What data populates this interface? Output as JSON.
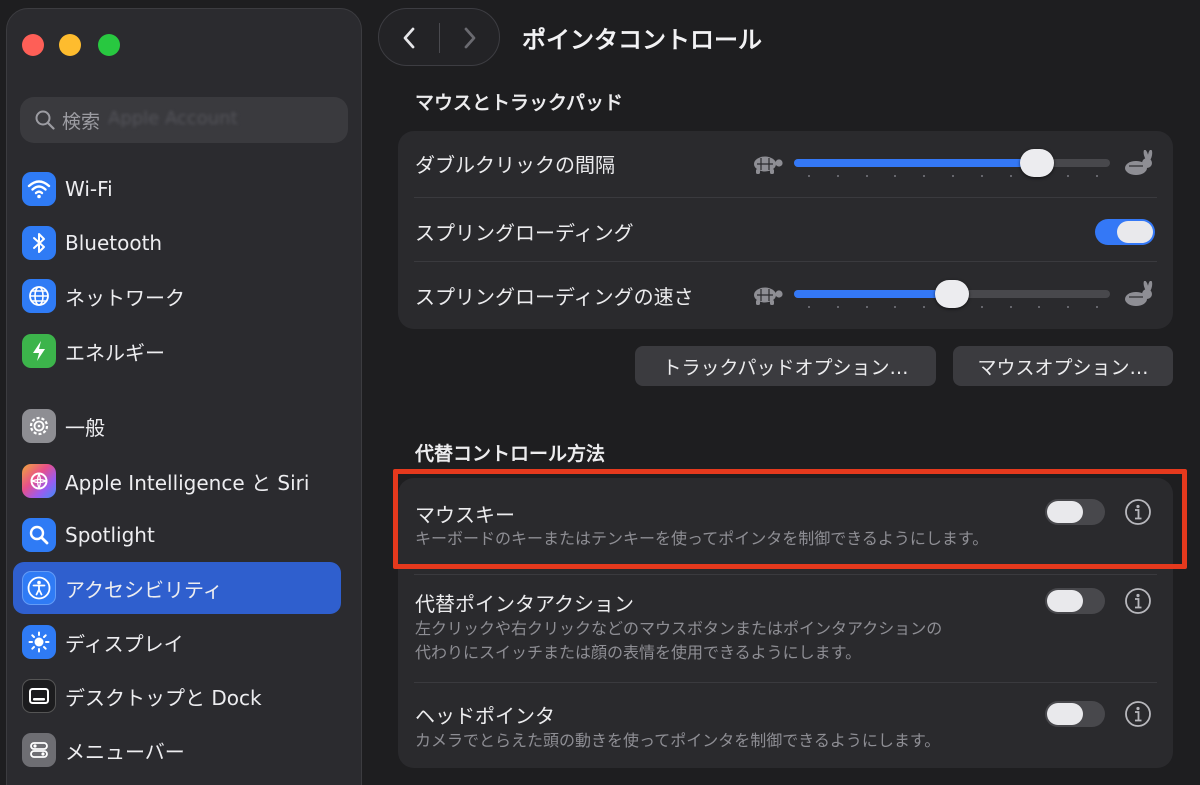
{
  "window": {
    "title": "ポインタコントロール"
  },
  "sidebar": {
    "search_placeholder": "検索",
    "search_ghost_text": "Apple Account",
    "items": [
      {
        "label": "Wi-Fi",
        "icon": "wifi-icon",
        "color": "#2f7bf5"
      },
      {
        "label": "Bluetooth",
        "icon": "bluetooth-icon",
        "color": "#2f7bf5"
      },
      {
        "label": "ネットワーク",
        "icon": "globe-icon",
        "color": "#2f7bf5"
      },
      {
        "label": "エネルギー",
        "icon": "bolt-icon",
        "color": "#3cb44b"
      },
      {
        "label": "一般",
        "icon": "gear-icon",
        "color": "#8e8e93"
      },
      {
        "label": "Apple Intelligence と Siri",
        "icon": "apple-intelligence-icon",
        "color": "#b064e8"
      },
      {
        "label": "Spotlight",
        "icon": "magnifier-icon",
        "color": "#2f7bf5"
      },
      {
        "label": "アクセシビリティ",
        "icon": "accessibility-icon",
        "color": "#2f7bf5",
        "selected": true
      },
      {
        "label": "ディスプレイ",
        "icon": "sun-icon",
        "color": "#2f7bf5"
      },
      {
        "label": "デスクトップと Dock",
        "icon": "dock-icon",
        "color": "#1c1c1e"
      },
      {
        "label": "メニューバー",
        "icon": "menubar-icon",
        "color": "#6e6e73"
      }
    ]
  },
  "main": {
    "section_mouse": {
      "title": "マウスとトラックパッド",
      "rows": {
        "double_click": {
          "label": "ダブルクリックの間隔",
          "value": 0.77
        },
        "spring_loading": {
          "label": "スプリングローディング",
          "on": true
        },
        "spring_speed": {
          "label": "スプリングローディングの速さ",
          "value": 0.5
        }
      },
      "buttons": {
        "trackpad": "トラックパッドオプション…",
        "mouse": "マウスオプション…"
      }
    },
    "section_alt": {
      "title": "代替コントロール方法",
      "rows": {
        "mouse_keys": {
          "label": "マウスキー",
          "desc": "キーボードのキーまたはテンキーを使ってポインタを制御できるようにします。",
          "on": false
        },
        "alt_pointer": {
          "label": "代替ポインタアクション",
          "desc_line1": "左クリックや右クリックなどのマウスボタンまたはポインタアクションの",
          "desc_line2": "代わりにスイッチまたは顔の表情を使用できるようにします。",
          "on": false
        },
        "head_pointer": {
          "label": "ヘッドポインタ",
          "desc": "カメラでとらえた頭の動きを使ってポインタを制御できるようにします。",
          "on": false
        }
      }
    },
    "highlight_color": "#e5391d",
    "accent_color": "#3478f6"
  }
}
